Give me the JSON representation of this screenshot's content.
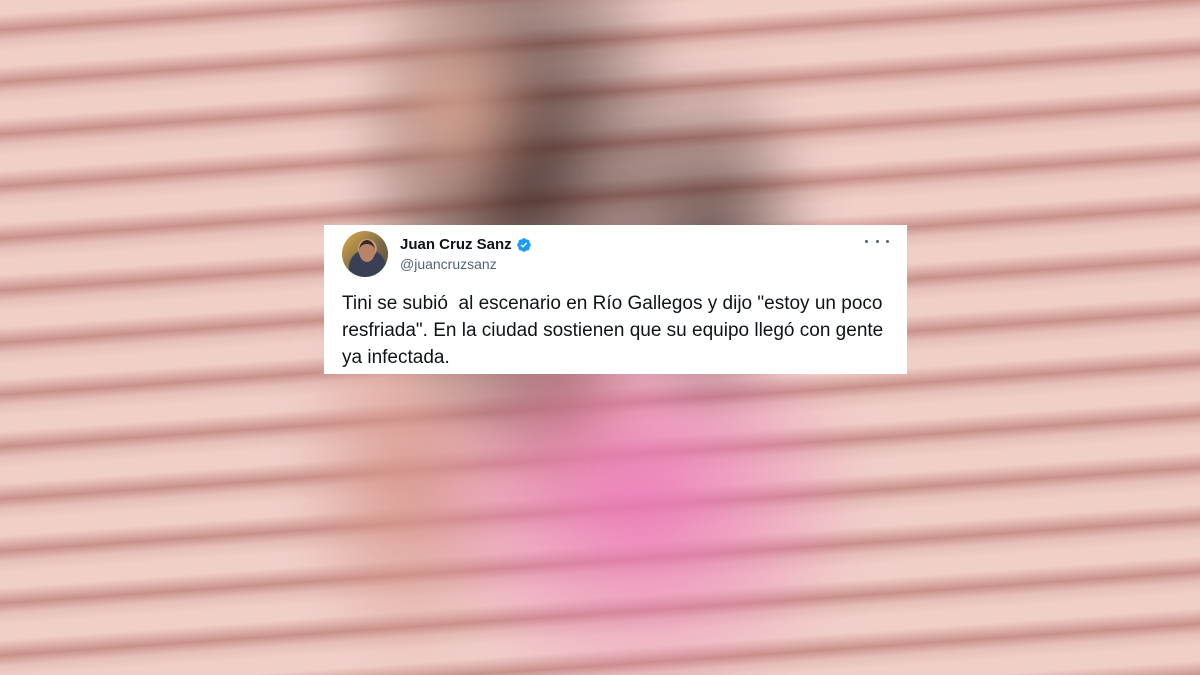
{
  "tweet": {
    "display_name": "Juan Cruz Sanz",
    "handle": "@juancruzsanz",
    "verified": true,
    "text": "Tini se subió  al escenario en Río Gallegos y dijo \"estoy un poco resfriada\". En la ciudad sostienen que su equipo llegó con gente ya infectada."
  },
  "icons": {
    "verified": "verified-badge-icon",
    "more": "more-options-icon"
  },
  "colors": {
    "verified_blue": "#1d9bf0",
    "text_primary": "#0f1419",
    "text_secondary": "#536471",
    "card_background": "#ffffff"
  }
}
